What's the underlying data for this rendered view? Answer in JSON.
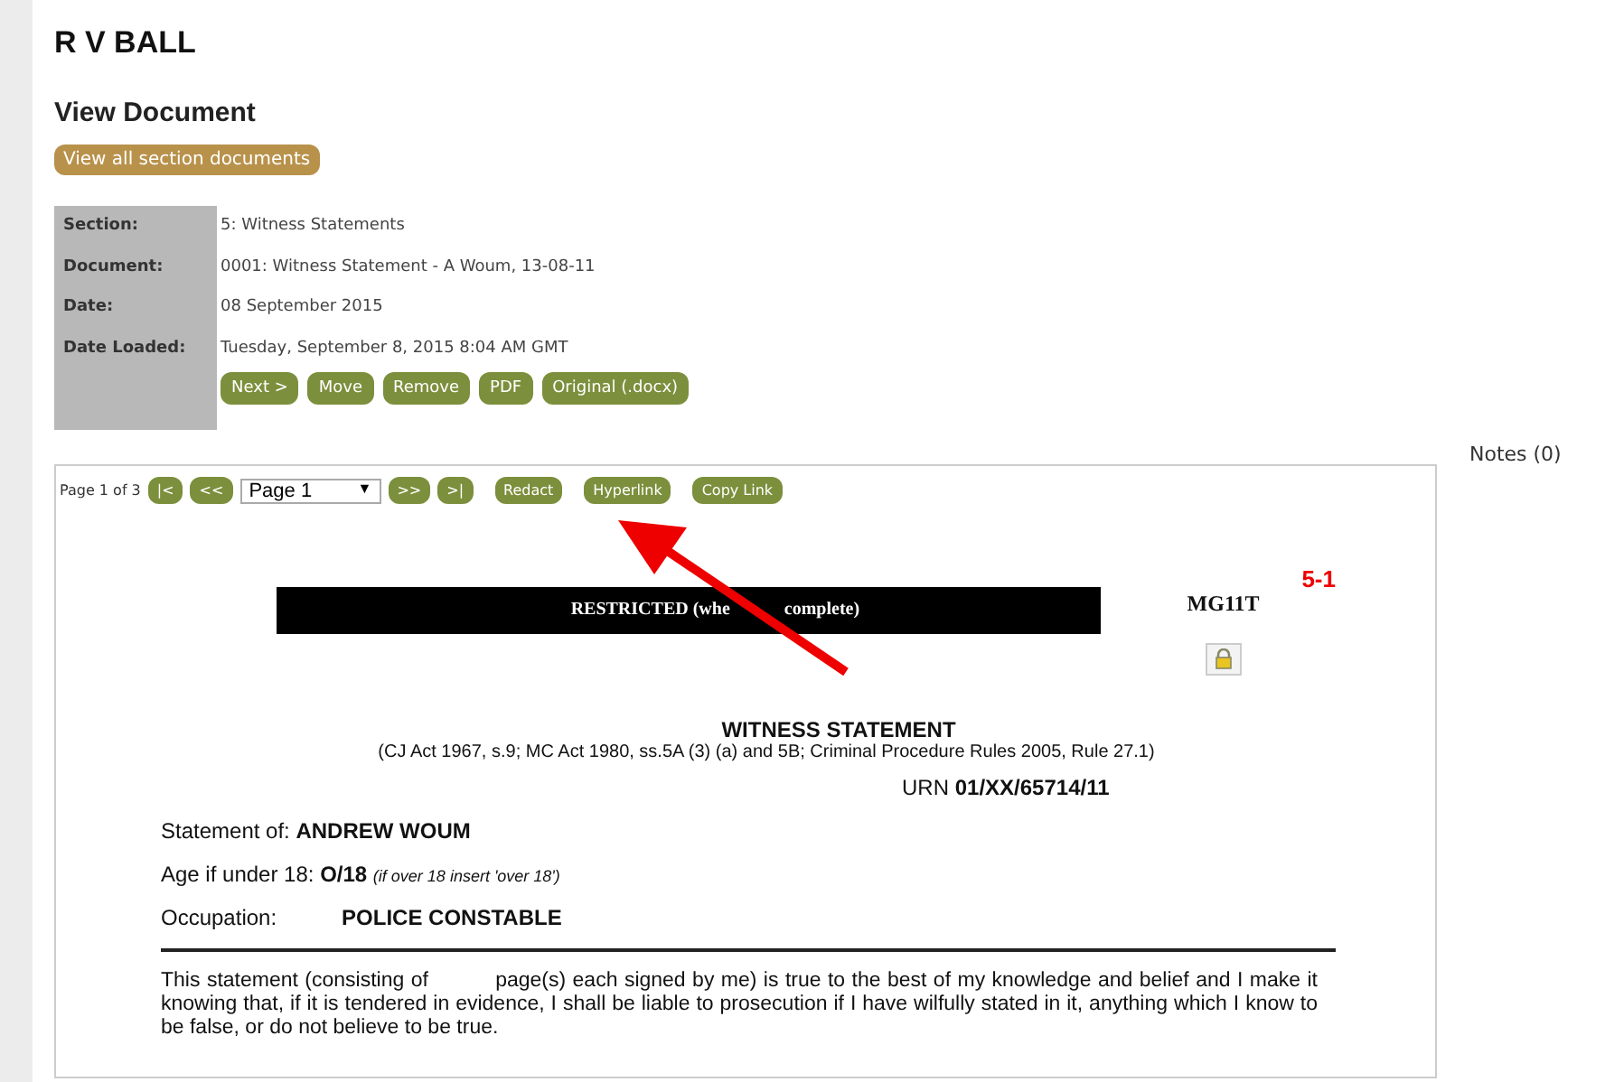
{
  "case_title": "R V BALL",
  "page_title": "View Document",
  "section_button": "View all section documents",
  "details": [
    {
      "label": "Section:",
      "value": "5: Witness Statements"
    },
    {
      "label": "Document:",
      "value": "0001: Witness Statement - A Woum, 13-08-11"
    },
    {
      "label": "Date:",
      "value": "08 September 2015"
    },
    {
      "label": "Date Loaded:",
      "value": "Tuesday, September 8, 2015 8:04 AM GMT"
    }
  ],
  "actions": [
    "Next >",
    "Move",
    "Remove",
    "PDF",
    "Original (.docx)"
  ],
  "viewer": {
    "page_info": "Page 1 of 3",
    "nav_back": [
      "|<",
      "<<"
    ],
    "page_select": "Page 1",
    "page_select_icon": "▼",
    "nav_forward": [
      ">>",
      ">|"
    ],
    "tools": [
      "Redact",
      "Hyperlink",
      "Copy Link"
    ]
  },
  "notes": "Notes (0)",
  "document": {
    "restricted": [
      "RESTRICTED (whe",
      "complete)"
    ],
    "form_code": "MG11T",
    "page_ref": "5-1",
    "heading": "WITNESS STATEMENT",
    "legal_basis": "(CJ Act 1967, s.9; MC Act 1980, ss.5A (3) (a) and 5B; Criminal Procedure Rules 2005, Rule 27.1)",
    "urn_label": "URN",
    "urn": "01/XX/65714/11",
    "statement_of_label": "Statement of:",
    "statement_of": "ANDREW WOUM",
    "age_label": "Age if under 18:",
    "age": "O/18",
    "age_hint": "(if over 18 insert 'over 18')",
    "occupation_label": "Occupation:",
    "occupation": "POLICE CONSTABLE",
    "declaration": "This statement (consisting of          page(s) each signed by me) is true to the best of my knowledge and belief and I make it knowing that, if it is tendered in evidence, I shall be liable to prosecution if I have wilfully stated in it, anything which I know to be false, or do not believe to be true."
  }
}
